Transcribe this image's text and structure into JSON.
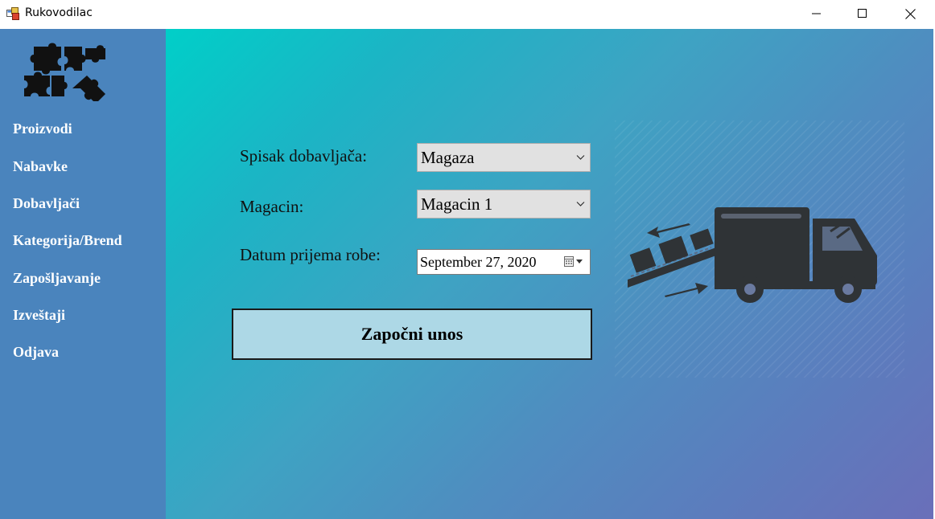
{
  "window": {
    "title": "Rukovodilac",
    "icon": "app-window-icon",
    "controls": [
      "minimize-icon",
      "maximize-icon",
      "close-icon"
    ]
  },
  "sidebar": {
    "logo": "puzzle-logo",
    "items": [
      {
        "label": "Proizvodi"
      },
      {
        "label": "Nabavke"
      },
      {
        "label": "Dobavljači"
      },
      {
        "label": "Kategorija/Brend"
      },
      {
        "label": "Zapošljavanje"
      },
      {
        "label": "Izveštaji"
      },
      {
        "label": "Odjava"
      }
    ],
    "color": "#4a84bd"
  },
  "form": {
    "supplier_label": "Spisak dobavljača:",
    "supplier_value": "Magaza",
    "warehouse_label": "Magacin:",
    "warehouse_value": "Magacin 1",
    "date_label": "Datum prijema robe:",
    "date_value": "September 27, 2020",
    "start_button": "Započni unos",
    "button_color": "#add8e6"
  },
  "illustration": "delivery-truck-icon"
}
